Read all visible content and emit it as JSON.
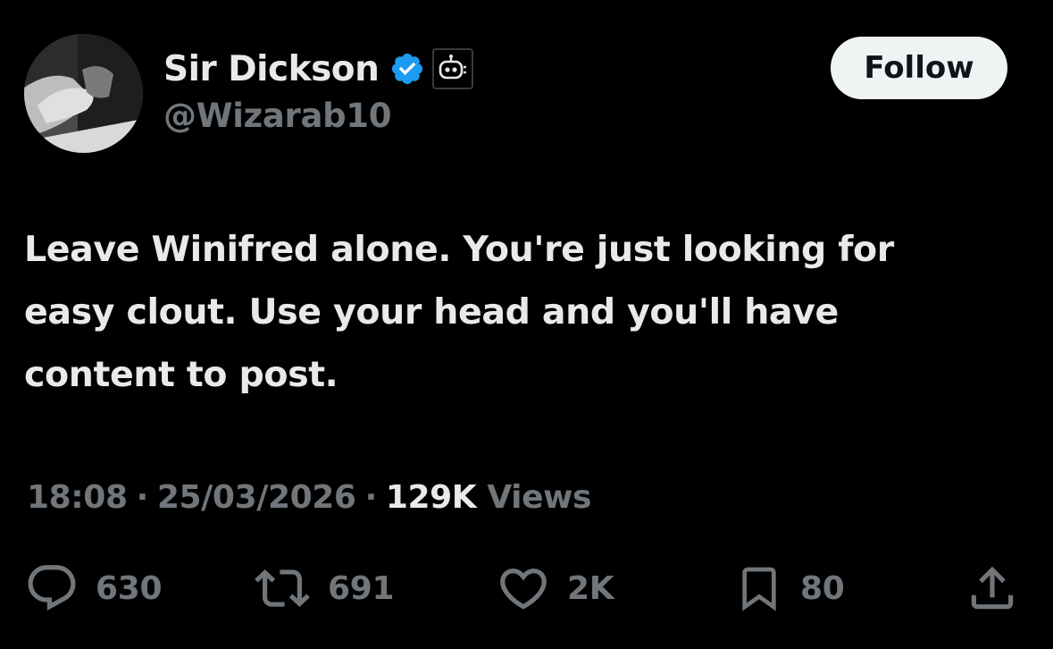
{
  "author": {
    "display_name": "Sir Dickson",
    "handle": "@Wizarab10",
    "verified": true,
    "verified_color": "#1d9bf0",
    "badge_icon": "automated-bot-icon"
  },
  "follow": {
    "label": "Follow"
  },
  "tweet": {
    "text": "Leave Winifred alone. You're just looking for\neasy clout. Use your head and you'll have\ncontent to post."
  },
  "meta": {
    "time": "18:08",
    "separator": "·",
    "date": "25/03/2026",
    "views_count": "129K",
    "views_label": "Views"
  },
  "actions": {
    "reply": {
      "icon": "reply-icon",
      "count": "630"
    },
    "retweet": {
      "icon": "retweet-icon",
      "count": "691"
    },
    "like": {
      "icon": "heart-icon",
      "count": "2K"
    },
    "bookmark": {
      "icon": "bookmark-icon",
      "count": "80"
    },
    "share": {
      "icon": "share-icon"
    }
  },
  "colors": {
    "background": "#000000",
    "text_primary": "#e7e9ea",
    "text_secondary": "#71767b",
    "follow_bg": "#eff3f4",
    "follow_text": "#0f1419"
  }
}
